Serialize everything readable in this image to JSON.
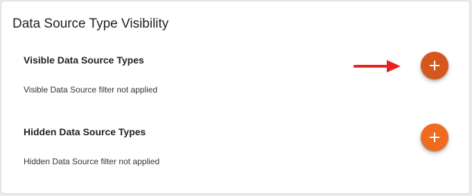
{
  "panel": {
    "title": "Data Source Type Visibility"
  },
  "visible_section": {
    "title": "Visible Data Source Types",
    "description": "Visible Data Source filter not applied",
    "add_button_icon": "plus-icon",
    "add_button_color": "#d4581c"
  },
  "hidden_section": {
    "title": "Hidden Data Source Types",
    "description": "Hidden Data Source filter not applied",
    "add_button_icon": "plus-icon",
    "add_button_color": "#ee6b1f"
  },
  "annotation": {
    "icon": "red-arrow-icon",
    "color": "#e8211c"
  }
}
